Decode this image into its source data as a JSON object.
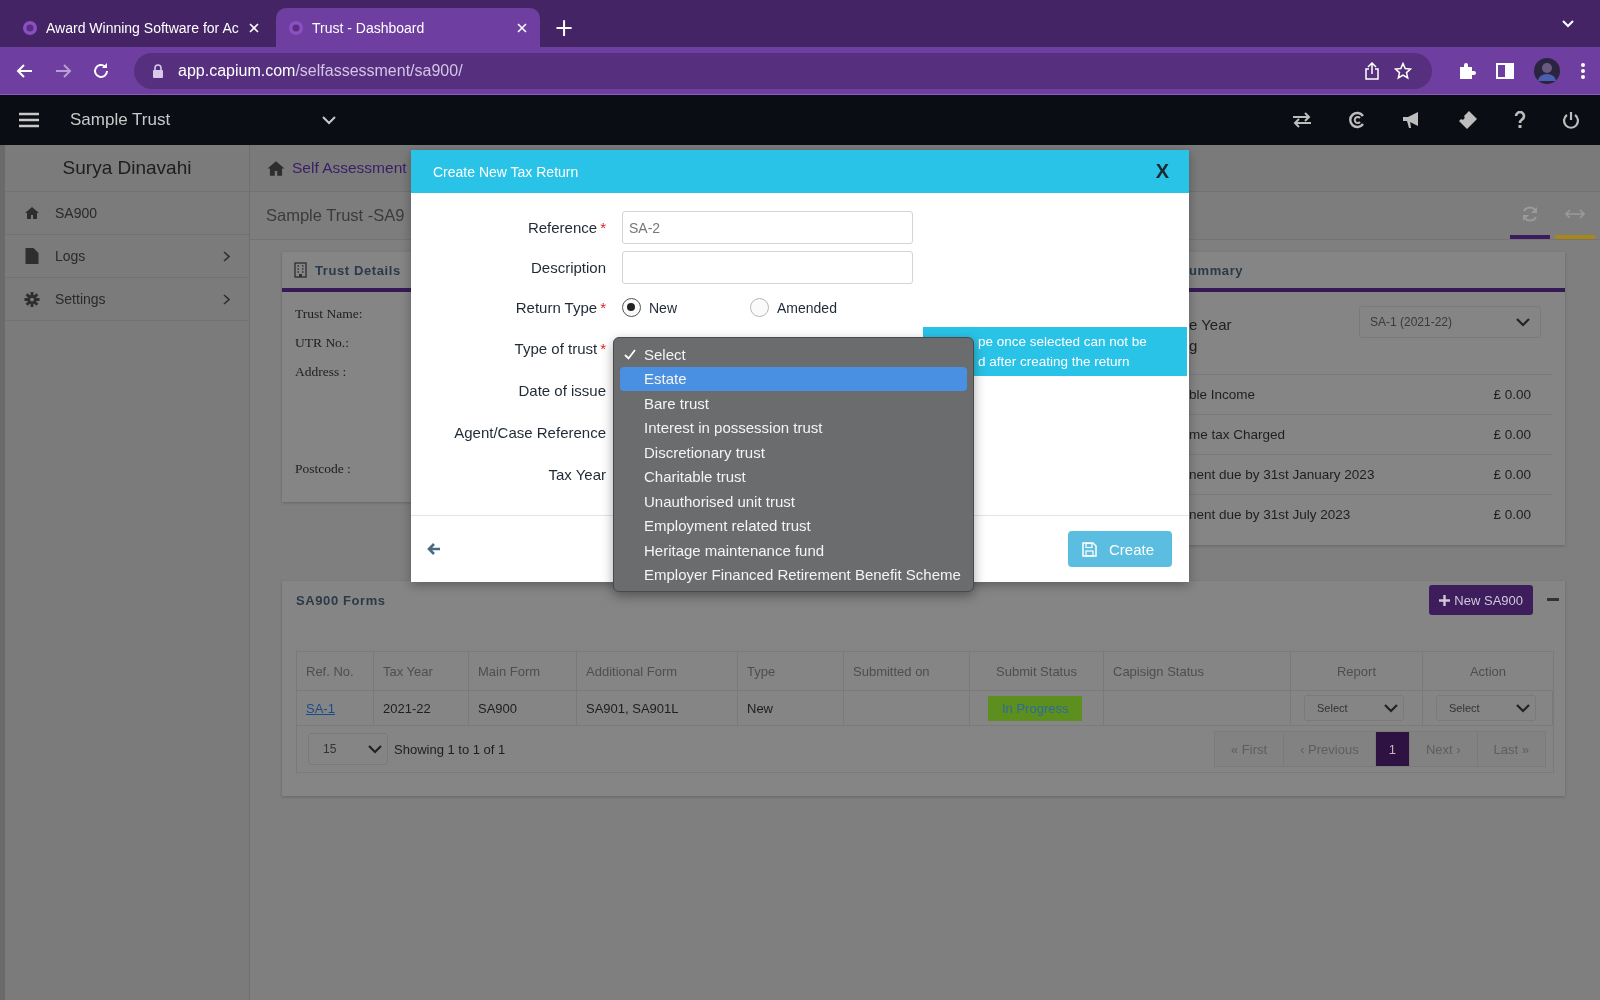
{
  "browser": {
    "tabs": [
      {
        "title": "Award Winning Software for Ac",
        "selected": false
      },
      {
        "title": "Trust - Dashboard",
        "selected": true
      }
    ],
    "new_tab": "+",
    "url": {
      "domain": "app.capium.com",
      "path": "/selfassessment/sa900/"
    }
  },
  "app_header": {
    "client": "Sample Trust"
  },
  "sidebar": {
    "user": "Surya Dinavahi",
    "items": [
      {
        "label": "SA900",
        "kind": "home",
        "submenu": false
      },
      {
        "label": "Logs",
        "kind": "file",
        "submenu": true
      },
      {
        "label": "Settings",
        "kind": "gear",
        "submenu": true
      }
    ]
  },
  "breadcrumb": "Self Assessment",
  "page_title": "Sample Trust -SA9",
  "trust_details": {
    "title": "Trust Details",
    "fields": [
      "Trust Name:",
      "UTR No.:",
      "Address :",
      "Postcode :"
    ]
  },
  "summary": {
    "title": "ummary",
    "year_label": [
      "e Year",
      "g"
    ],
    "year_select": "SA-1 (2021-22)",
    "rows": [
      {
        "label": "ble Income",
        "value": "£ 0.00"
      },
      {
        "label": "me tax Charged",
        "value": "£ 0.00"
      },
      {
        "label": "nent due by 31st January 2023",
        "value": "£ 0.00"
      },
      {
        "label": "nent due by 31st July 2023",
        "value": "£ 0.00"
      }
    ]
  },
  "forms": {
    "title": "SA900 Forms",
    "new_button": "New SA900",
    "columns": [
      "Ref. No.",
      "Tax Year",
      "Main Form",
      "Additional Form",
      "Type",
      "Submitted on",
      "Submit Status",
      "Capisign Status",
      "Report",
      "Action"
    ],
    "rows": [
      {
        "cells": [
          {
            "kind": "link",
            "text": "SA-1"
          },
          {
            "kind": "text",
            "text": "2021-22"
          },
          {
            "kind": "text",
            "text": "SA900"
          },
          {
            "kind": "text",
            "text": "SA901, SA901L"
          },
          {
            "kind": "text",
            "text": "New"
          },
          {
            "kind": "empty"
          },
          {
            "kind": "badge",
            "text": "In Progress"
          },
          {
            "kind": "empty"
          },
          {
            "kind": "select",
            "text": "Select"
          },
          {
            "kind": "select",
            "text": "Select"
          }
        ]
      }
    ],
    "page_size": "15",
    "showing": "Showing 1 to 1 of 1",
    "pagination": [
      {
        "label": "« First",
        "selected": false,
        "disabled": true
      },
      {
        "label": "‹ Previous",
        "selected": false,
        "disabled": true
      },
      {
        "label": "1",
        "selected": true,
        "disabled": false
      },
      {
        "label": "Next ›",
        "selected": false,
        "disabled": true
      },
      {
        "label": "Last »",
        "selected": false,
        "disabled": true
      }
    ]
  },
  "modal": {
    "title": "Create New Tax Return",
    "close": "X",
    "fields": [
      {
        "label": "Reference",
        "required_mark": "*",
        "kind": "text",
        "placeholder": "SA-2"
      },
      {
        "label": "Description",
        "kind": "text"
      },
      {
        "label": "Return Type",
        "required_mark": "*",
        "kind": "radio",
        "options": [
          {
            "label": "New",
            "selected": true
          },
          {
            "label": "Amended",
            "selected": false
          }
        ]
      },
      {
        "label": "Type of trust",
        "required_mark": "*",
        "kind": "covered"
      },
      {
        "label": "Date of issue",
        "kind": "covered"
      },
      {
        "label": "Agent/Case Reference",
        "kind": "covered"
      },
      {
        "label": "Tax Year",
        "kind": "covered"
      }
    ],
    "create_button": "Create",
    "dropdown_options": [
      {
        "label": "Select",
        "checked": true,
        "highlighted": false
      },
      {
        "label": "Estate",
        "checked": false,
        "highlighted": true
      },
      {
        "label": "Bare trust",
        "checked": false,
        "highlighted": false
      },
      {
        "label": "Interest in possession trust",
        "checked": false,
        "highlighted": false
      },
      {
        "label": "Discretionary trust",
        "checked": false,
        "highlighted": false
      },
      {
        "label": "Charitable trust",
        "checked": false,
        "highlighted": false
      },
      {
        "label": "Unauthorised unit trust",
        "checked": false,
        "highlighted": false
      },
      {
        "label": "Employment related trust",
        "checked": false,
        "highlighted": false
      },
      {
        "label": "Heritage maintenance fund",
        "checked": false,
        "highlighted": false
      },
      {
        "label": "Employer Financed Retirement Benefit Scheme",
        "checked": false,
        "highlighted": false
      }
    ],
    "tooltip": [
      "pe once selected can not be",
      "d after creating the return"
    ]
  }
}
